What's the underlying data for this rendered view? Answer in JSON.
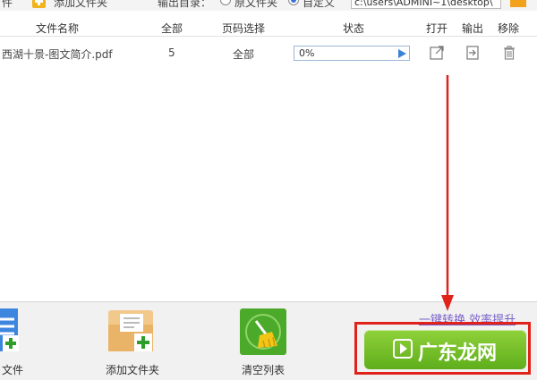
{
  "toolbar": {
    "add_files_label": "件",
    "add_folder_label": "添加文件夹",
    "output_dir_label": "输出目录：",
    "option_source_label": "原文件夹",
    "option_custom_label": "自定义",
    "output_path": "c:\\users\\ADMINI~1\\desktop\\"
  },
  "table": {
    "headers": {
      "name": "文件名称",
      "total": "全部",
      "page_select": "页码选择",
      "status": "状态",
      "open": "打开",
      "output": "输出",
      "remove": "移除"
    },
    "rows": [
      {
        "name": "西湖十景-图文简介.pdf",
        "total": "5",
        "pages": "全部",
        "progress_text": "0%",
        "progress": 0
      }
    ]
  },
  "bottom": {
    "add_file_label": "文件",
    "add_folder_label": "添加文件夹",
    "clear_list_label": "清空列表",
    "slogan": "一键转换  效率提升",
    "start_label": "广东龙网"
  },
  "colors": {
    "accent_green": "#6cbb25",
    "highlight_red": "#e0221a",
    "progress_blue": "#3b83d6"
  }
}
